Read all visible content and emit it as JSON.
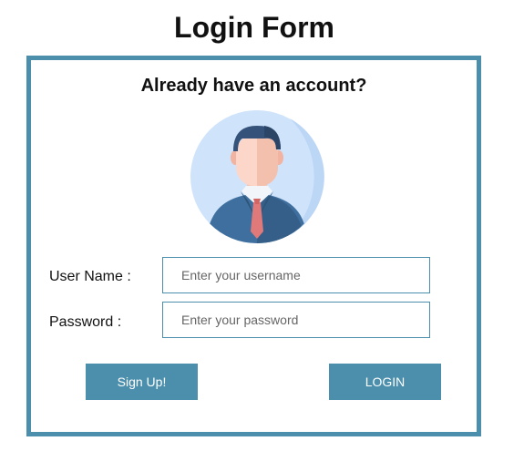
{
  "page": {
    "title": "Login Form"
  },
  "form": {
    "heading": "Already have an account?",
    "avatar_icon": "user-avatar-icon",
    "username": {
      "label": "User Name :",
      "value": "",
      "placeholder": "Enter your username"
    },
    "password": {
      "label": "Password :",
      "value": "",
      "placeholder": "Enter your password"
    },
    "buttons": {
      "signup_label": "Sign Up!",
      "login_label": "LOGIN"
    }
  },
  "colors": {
    "accent": "#4b8fac",
    "button_text": "#ffffff",
    "avatar_bg": "#cfe3fb"
  }
}
